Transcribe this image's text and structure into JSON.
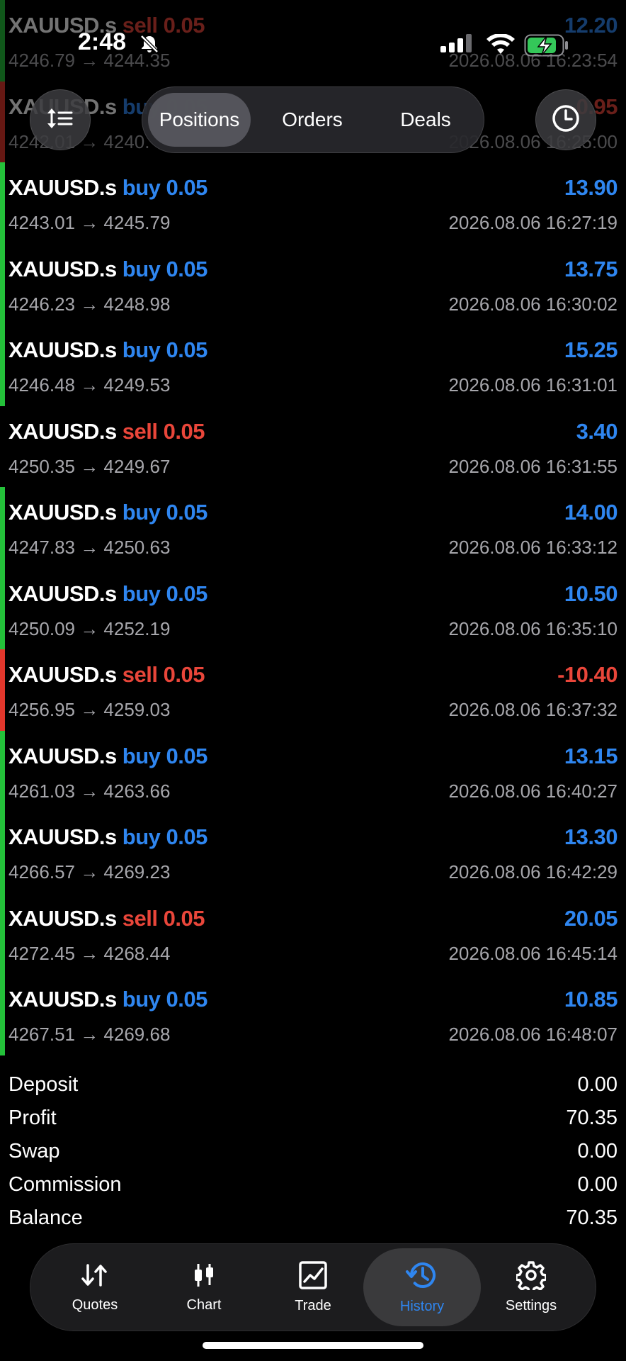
{
  "status_bar": {
    "time": "2:48"
  },
  "segments": [
    "Positions",
    "Orders",
    "Deals"
  ],
  "trades": [
    {
      "symbol": "XAUUSD.s",
      "side": "sell",
      "volume": "0.05",
      "prices": "4246.79 → 4244.35",
      "profit": "12.20",
      "time": "2026.08.06 16:23:54",
      "bar": "green"
    },
    {
      "symbol": "XAUUSD.s",
      "side": "buy",
      "volume": "0.05",
      "prices": "4242.01 → 4240.",
      "profit": "-0.95",
      "time": "2026.08.06 16:25:00",
      "bar": "red"
    },
    {
      "symbol": "XAUUSD.s",
      "side": "buy",
      "volume": "0.05",
      "prices": "4243.01 → 4245.79",
      "profit": "13.90",
      "time": "2026.08.06 16:27:19",
      "bar": "green"
    },
    {
      "symbol": "XAUUSD.s",
      "side": "buy",
      "volume": "0.05",
      "prices": "4246.23 → 4248.98",
      "profit": "13.75",
      "time": "2026.08.06 16:30:02",
      "bar": "green"
    },
    {
      "symbol": "XAUUSD.s",
      "side": "buy",
      "volume": "0.05",
      "prices": "4246.48 → 4249.53",
      "profit": "15.25",
      "time": "2026.08.06 16:31:01",
      "bar": "green"
    },
    {
      "symbol": "XAUUSD.s",
      "side": "sell",
      "volume": "0.05",
      "prices": "4250.35 → 4249.67",
      "profit": "3.40",
      "time": "2026.08.06 16:31:55",
      "bar": "none"
    },
    {
      "symbol": "XAUUSD.s",
      "side": "buy",
      "volume": "0.05",
      "prices": "4247.83 → 4250.63",
      "profit": "14.00",
      "time": "2026.08.06 16:33:12",
      "bar": "green"
    },
    {
      "symbol": "XAUUSD.s",
      "side": "buy",
      "volume": "0.05",
      "prices": "4250.09 → 4252.19",
      "profit": "10.50",
      "time": "2026.08.06 16:35:10",
      "bar": "green"
    },
    {
      "symbol": "XAUUSD.s",
      "side": "sell",
      "volume": "0.05",
      "prices": "4256.95 → 4259.03",
      "profit": "-10.40",
      "time": "2026.08.06 16:37:32",
      "bar": "red"
    },
    {
      "symbol": "XAUUSD.s",
      "side": "buy",
      "volume": "0.05",
      "prices": "4261.03 → 4263.66",
      "profit": "13.15",
      "time": "2026.08.06 16:40:27",
      "bar": "green"
    },
    {
      "symbol": "XAUUSD.s",
      "side": "buy",
      "volume": "0.05",
      "prices": "4266.57 → 4269.23",
      "profit": "13.30",
      "time": "2026.08.06 16:42:29",
      "bar": "green"
    },
    {
      "symbol": "XAUUSD.s",
      "side": "sell",
      "volume": "0.05",
      "prices": "4272.45 → 4268.44",
      "profit": "20.05",
      "time": "2026.08.06 16:45:14",
      "bar": "green"
    },
    {
      "symbol": "XAUUSD.s",
      "side": "buy",
      "volume": "0.05",
      "prices": "4267.51 → 4269.68",
      "profit": "10.85",
      "time": "2026.08.06 16:48:07",
      "bar": "green"
    }
  ],
  "summary": [
    {
      "label": "Deposit",
      "value": "0.00"
    },
    {
      "label": "Profit",
      "value": "70.35"
    },
    {
      "label": "Swap",
      "value": "0.00"
    },
    {
      "label": "Commission",
      "value": "0.00"
    },
    {
      "label": "Balance",
      "value": "70.35"
    }
  ],
  "tabs": [
    {
      "label": "Quotes",
      "icon": "quotes-arrows-icon"
    },
    {
      "label": "Chart",
      "icon": "candlestick-icon"
    },
    {
      "label": "Trade",
      "icon": "trade-chart-icon"
    },
    {
      "label": "History",
      "icon": "history-clock-icon"
    },
    {
      "label": "Settings",
      "icon": "gear-icon"
    }
  ],
  "colors": {
    "buy": "#2f86f0",
    "sell": "#e9463a",
    "profit_bar": "#24c13a",
    "loss_bar": "#e2372c",
    "active_tab": "#2f86f0"
  }
}
